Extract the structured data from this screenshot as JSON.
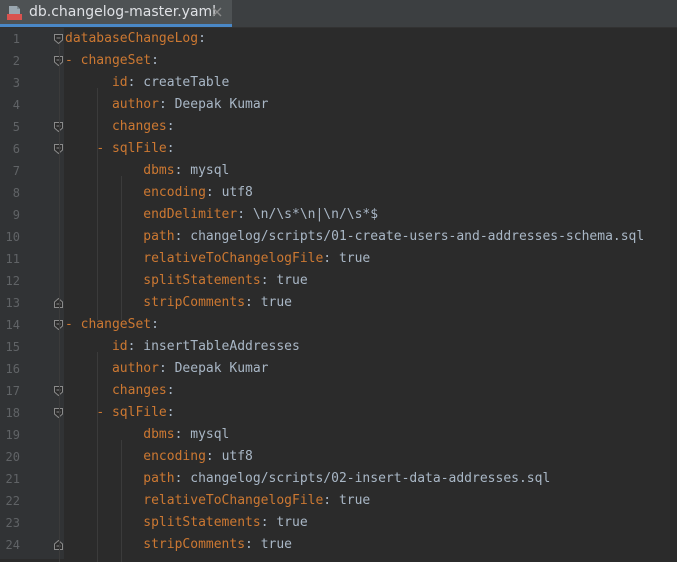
{
  "tab": {
    "title": "db.changelog-master.yaml",
    "icon": "yml-file-icon",
    "close_icon": "close-icon"
  },
  "colors": {
    "key": "#cc7832",
    "value": "#a9b7c6",
    "line_number": "#606366",
    "background": "#2b2b2b",
    "gutter": "#313335",
    "tab_underline": "#4a88c7"
  },
  "editor": {
    "lines": [
      {
        "n": "1",
        "indent": 0,
        "dash": false,
        "key": "databaseChangeLog",
        "sep": ":",
        "value": "",
        "fold": "open"
      },
      {
        "n": "2",
        "indent": 2,
        "dash": true,
        "key": "changeSet",
        "sep": ":",
        "value": "",
        "fold": "open"
      },
      {
        "n": "3",
        "indent": 6,
        "dash": false,
        "key": "id",
        "sep": ": ",
        "value": "createTable",
        "fold": ""
      },
      {
        "n": "4",
        "indent": 6,
        "dash": false,
        "key": "author",
        "sep": ": ",
        "value": "Deepak Kumar",
        "fold": ""
      },
      {
        "n": "5",
        "indent": 6,
        "dash": false,
        "key": "changes",
        "sep": ":",
        "value": "",
        "fold": "open"
      },
      {
        "n": "6",
        "indent": 6,
        "dash": true,
        "key": "sqlFile",
        "sep": ":",
        "value": "",
        "fold": "open"
      },
      {
        "n": "7",
        "indent": 10,
        "dash": false,
        "key": "dbms",
        "sep": ": ",
        "value": "mysql",
        "fold": ""
      },
      {
        "n": "8",
        "indent": 10,
        "dash": false,
        "key": "encoding",
        "sep": ": ",
        "value": "utf8",
        "fold": ""
      },
      {
        "n": "9",
        "indent": 10,
        "dash": false,
        "key": "endDelimiter",
        "sep": ": ",
        "value": "\\n/\\s*\\n|\\n/\\s*$",
        "fold": ""
      },
      {
        "n": "10",
        "indent": 10,
        "dash": false,
        "key": "path",
        "sep": ": ",
        "value": "changelog/scripts/01-create-users-and-addresses-schema.sql",
        "fold": ""
      },
      {
        "n": "11",
        "indent": 10,
        "dash": false,
        "key": "relativeToChangelogFile",
        "sep": ": ",
        "value": "true",
        "fold": ""
      },
      {
        "n": "12",
        "indent": 10,
        "dash": false,
        "key": "splitStatements",
        "sep": ": ",
        "value": "true",
        "fold": ""
      },
      {
        "n": "13",
        "indent": 10,
        "dash": false,
        "key": "stripComments",
        "sep": ": ",
        "value": "true",
        "fold": "end"
      },
      {
        "n": "14",
        "indent": 2,
        "dash": true,
        "key": "changeSet",
        "sep": ":",
        "value": "",
        "fold": "open"
      },
      {
        "n": "15",
        "indent": 6,
        "dash": false,
        "key": "id",
        "sep": ": ",
        "value": "insertTableAddresses",
        "fold": ""
      },
      {
        "n": "16",
        "indent": 6,
        "dash": false,
        "key": "author",
        "sep": ": ",
        "value": "Deepak Kumar",
        "fold": ""
      },
      {
        "n": "17",
        "indent": 6,
        "dash": false,
        "key": "changes",
        "sep": ":",
        "value": "",
        "fold": "open"
      },
      {
        "n": "18",
        "indent": 6,
        "dash": true,
        "key": "sqlFile",
        "sep": ":",
        "value": "",
        "fold": "open"
      },
      {
        "n": "19",
        "indent": 10,
        "dash": false,
        "key": "dbms",
        "sep": ": ",
        "value": "mysql",
        "fold": ""
      },
      {
        "n": "20",
        "indent": 10,
        "dash": false,
        "key": "encoding",
        "sep": ": ",
        "value": "utf8",
        "fold": ""
      },
      {
        "n": "21",
        "indent": 10,
        "dash": false,
        "key": "path",
        "sep": ": ",
        "value": "changelog/scripts/02-insert-data-addresses.sql",
        "fold": ""
      },
      {
        "n": "22",
        "indent": 10,
        "dash": false,
        "key": "relativeToChangelogFile",
        "sep": ": ",
        "value": "true",
        "fold": ""
      },
      {
        "n": "23",
        "indent": 10,
        "dash": false,
        "key": "splitStatements",
        "sep": ": ",
        "value": "true",
        "fold": ""
      },
      {
        "n": "24",
        "indent": 10,
        "dash": false,
        "key": "stripComments",
        "sep": ": ",
        "value": "true",
        "fold": "end"
      }
    ]
  }
}
